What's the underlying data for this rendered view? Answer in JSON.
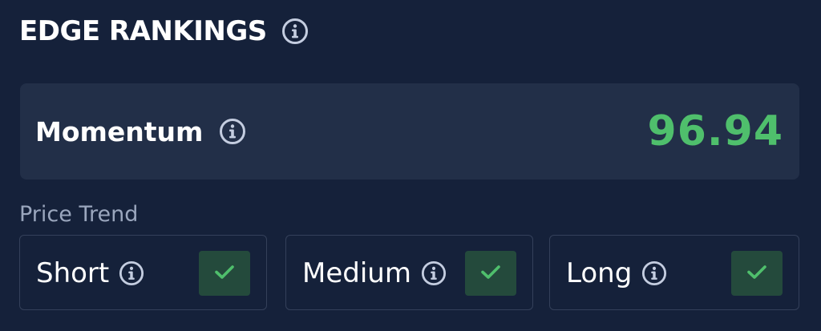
{
  "header": {
    "title": "EDGE RANKINGS",
    "info_icon": "info-icon"
  },
  "momentum": {
    "label": "Momentum",
    "value": "96.94",
    "value_color": "#4fbf6c"
  },
  "price_trend": {
    "label": "Price Trend",
    "items": [
      {
        "label": "Short",
        "checked": true
      },
      {
        "label": "Medium",
        "checked": true
      },
      {
        "label": "Long",
        "checked": true
      }
    ]
  },
  "colors": {
    "background": "#15213a",
    "card": "#222f48",
    "accent_green": "#4fbf6c",
    "check_bg": "#244a3c"
  }
}
